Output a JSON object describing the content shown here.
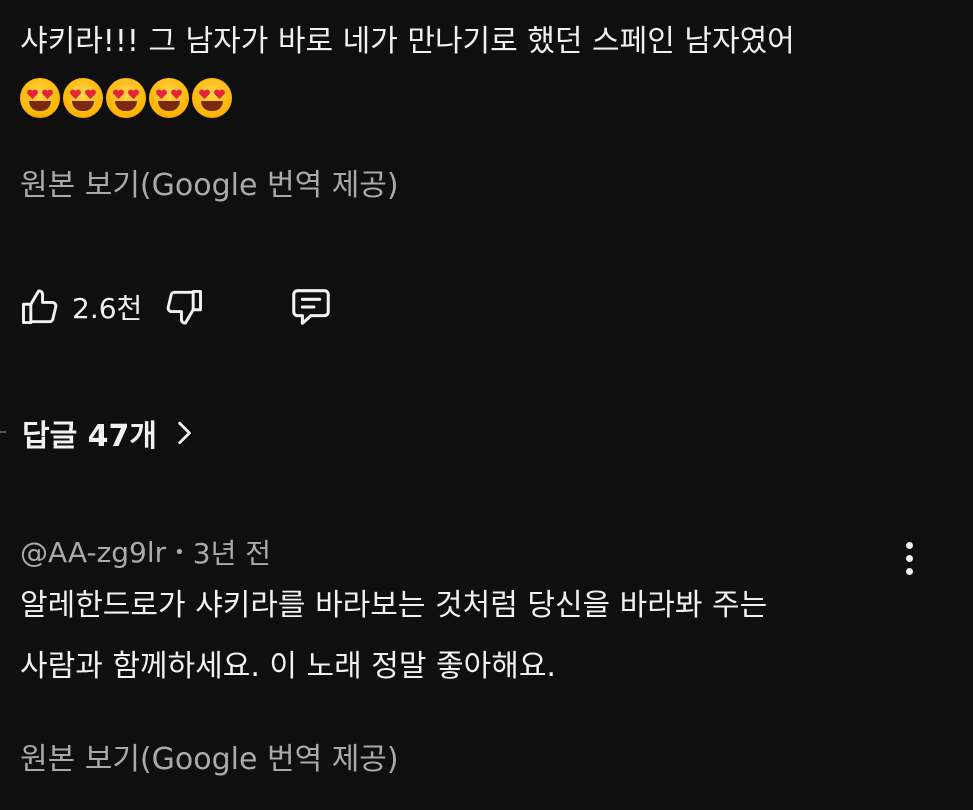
{
  "comment1": {
    "text": "샤키라!!! 그 남자가 바로 네가 만나기로 했던 스페인 남자였어",
    "emojis": [
      "heart-eyes",
      "heart-eyes",
      "heart-eyes",
      "heart-eyes",
      "heart-eyes"
    ],
    "see_original": "원본 보기(Google 번역 제공)",
    "like_count": "2.6천",
    "replies_label": "답글 47개"
  },
  "comment2": {
    "author": "@AA-zg9lr",
    "separator": "•",
    "time": "3년 전",
    "line1": "알레한드로가 샤키라를 바라보는 것처럼 당신을 바라봐 주는",
    "line2": "사람과 함께하세요. 이 노래 정말 좋아해요.",
    "see_original": "원본 보기(Google 번역 제공)"
  },
  "colors": {
    "background": "#0f0f0f",
    "text": "#f1f1f1",
    "secondary_text": "#aaaaaa"
  }
}
